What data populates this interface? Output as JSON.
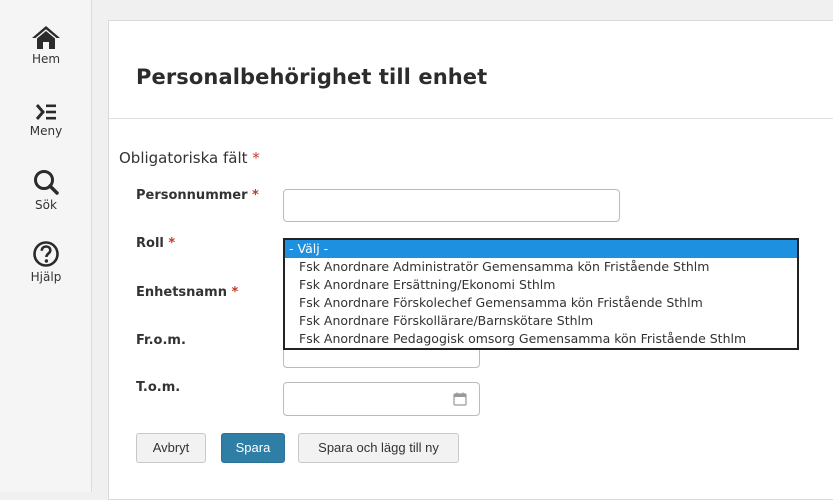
{
  "sidebar": {
    "items": [
      {
        "label": "Hem",
        "icon": "home-icon"
      },
      {
        "label": "Meny",
        "icon": "menu-icon"
      },
      {
        "label": "Sök",
        "icon": "search-icon"
      },
      {
        "label": "Hjälp",
        "icon": "help-icon"
      }
    ]
  },
  "page": {
    "title": "Personalbehörighet till enhet",
    "mandatory_text": "Obligatoriska fält",
    "required_marker": "*"
  },
  "form": {
    "personnummer_label": "Personnummer",
    "personnummer_value": "",
    "roll_label": "Roll",
    "enhetsnamn_label": "Enhetsnamn",
    "from_label": "Fr.o.m.",
    "tom_label": "T.o.m.",
    "tom_value": ""
  },
  "roll_dropdown": {
    "options": [
      "- Välj -",
      "Fsk Anordnare Administratör Gemensamma kön Fristående Sthlm",
      "Fsk Anordnare Ersättning/Ekonomi Sthlm",
      "Fsk Anordnare Förskolechef Gemensamma kön Fristående Sthlm",
      "Fsk Anordnare Förskollärare/Barnskötare Sthlm",
      "Fsk Anordnare Pedagogisk omsorg Gemensamma kön Fristående Sthlm"
    ],
    "selected_index": 0
  },
  "buttons": {
    "cancel": "Avbryt",
    "save": "Spara",
    "save_add_new": "Spara och lägg till ny"
  },
  "colors": {
    "primary": "#2f7ea6",
    "required": "#c0392b",
    "selected_option": "#1e90e0"
  }
}
